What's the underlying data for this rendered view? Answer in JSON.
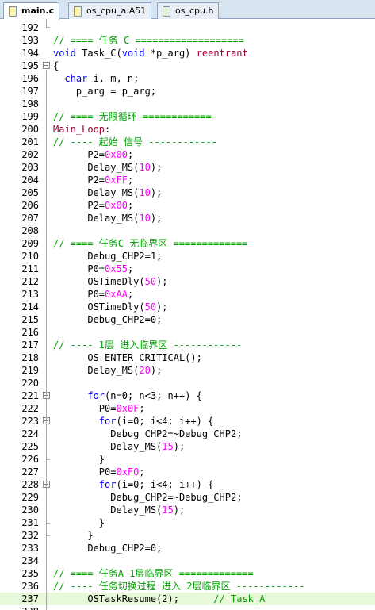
{
  "tabs": [
    {
      "label": "main.c",
      "active": true
    },
    {
      "label": "os_cpu_a.A51",
      "active": false
    },
    {
      "label": "os_cpu.h",
      "active": false
    }
  ],
  "lines": [
    {
      "n": "192",
      "segs": []
    },
    {
      "n": "193",
      "segs": [
        {
          "c": "cm",
          "t": "// ==== 任务 C ==================="
        }
      ]
    },
    {
      "n": "194",
      "segs": [
        {
          "c": "kw",
          "t": "void"
        },
        {
          "c": "txt",
          "t": " Task_C("
        },
        {
          "c": "kw",
          "t": "void"
        },
        {
          "c": "txt",
          "t": " *p_arg) "
        },
        {
          "c": "lbl",
          "t": "reentrant"
        }
      ]
    },
    {
      "n": "195",
      "fold": "-",
      "segs": [
        {
          "c": "txt",
          "t": "{"
        }
      ]
    },
    {
      "n": "196",
      "segs": [
        {
          "c": "txt",
          "t": "  "
        },
        {
          "c": "kw",
          "t": "char"
        },
        {
          "c": "txt",
          "t": " i, m, n;"
        }
      ]
    },
    {
      "n": "197",
      "segs": [
        {
          "c": "txt",
          "t": "    p_arg = p_arg;"
        }
      ]
    },
    {
      "n": "198",
      "segs": []
    },
    {
      "n": "199",
      "segs": [
        {
          "c": "cm",
          "t": "// ==== 无限循环 ============"
        }
      ]
    },
    {
      "n": "200",
      "segs": [
        {
          "c": "lbl",
          "t": "Main_Loop"
        },
        {
          "c": "txt",
          "t": ":"
        }
      ]
    },
    {
      "n": "201",
      "segs": [
        {
          "c": "cm",
          "t": "// ---- 起始 信号 ------------"
        }
      ]
    },
    {
      "n": "202",
      "segs": [
        {
          "c": "txt",
          "t": "      P2="
        },
        {
          "c": "num",
          "t": "0x00"
        },
        {
          "c": "txt",
          "t": ";"
        }
      ]
    },
    {
      "n": "203",
      "segs": [
        {
          "c": "txt",
          "t": "      Delay_MS("
        },
        {
          "c": "num",
          "t": "10"
        },
        {
          "c": "txt",
          "t": ");"
        }
      ]
    },
    {
      "n": "204",
      "segs": [
        {
          "c": "txt",
          "t": "      P2="
        },
        {
          "c": "num",
          "t": "0xFF"
        },
        {
          "c": "txt",
          "t": ";"
        }
      ]
    },
    {
      "n": "205",
      "segs": [
        {
          "c": "txt",
          "t": "      Delay_MS("
        },
        {
          "c": "num",
          "t": "10"
        },
        {
          "c": "txt",
          "t": ");"
        }
      ]
    },
    {
      "n": "206",
      "segs": [
        {
          "c": "txt",
          "t": "      P2="
        },
        {
          "c": "num",
          "t": "0x00"
        },
        {
          "c": "txt",
          "t": ";"
        }
      ]
    },
    {
      "n": "207",
      "segs": [
        {
          "c": "txt",
          "t": "      Delay_MS("
        },
        {
          "c": "num",
          "t": "10"
        },
        {
          "c": "txt",
          "t": ");"
        }
      ]
    },
    {
      "n": "208",
      "segs": []
    },
    {
      "n": "209",
      "segs": [
        {
          "c": "cm",
          "t": "// ==== 任务C 无临界区 ============="
        }
      ]
    },
    {
      "n": "210",
      "segs": [
        {
          "c": "txt",
          "t": "      Debug_CHP2=1;"
        }
      ]
    },
    {
      "n": "211",
      "segs": [
        {
          "c": "txt",
          "t": "      P0="
        },
        {
          "c": "num",
          "t": "0x55"
        },
        {
          "c": "txt",
          "t": ";"
        }
      ]
    },
    {
      "n": "212",
      "segs": [
        {
          "c": "txt",
          "t": "      OSTimeDly("
        },
        {
          "c": "num",
          "t": "50"
        },
        {
          "c": "txt",
          "t": ");"
        }
      ]
    },
    {
      "n": "213",
      "segs": [
        {
          "c": "txt",
          "t": "      P0="
        },
        {
          "c": "num",
          "t": "0xAA"
        },
        {
          "c": "txt",
          "t": ";"
        }
      ]
    },
    {
      "n": "214",
      "segs": [
        {
          "c": "txt",
          "t": "      OSTimeDly("
        },
        {
          "c": "num",
          "t": "50"
        },
        {
          "c": "txt",
          "t": ");"
        }
      ]
    },
    {
      "n": "215",
      "segs": [
        {
          "c": "txt",
          "t": "      Debug_CHP2=0;"
        }
      ]
    },
    {
      "n": "216",
      "segs": []
    },
    {
      "n": "217",
      "segs": [
        {
          "c": "cm",
          "t": "// ---- 1层 进入临界区 ------------"
        }
      ]
    },
    {
      "n": "218",
      "segs": [
        {
          "c": "txt",
          "t": "      OS_ENTER_CRITICAL();"
        }
      ]
    },
    {
      "n": "219",
      "segs": [
        {
          "c": "txt",
          "t": "      Delay_MS("
        },
        {
          "c": "num",
          "t": "20"
        },
        {
          "c": "txt",
          "t": ");"
        }
      ]
    },
    {
      "n": "220",
      "segs": []
    },
    {
      "n": "221",
      "fold": "-",
      "segs": [
        {
          "c": "txt",
          "t": "      "
        },
        {
          "c": "kw",
          "t": "for"
        },
        {
          "c": "txt",
          "t": "(n=0; n<3; n++) {"
        }
      ]
    },
    {
      "n": "222",
      "segs": [
        {
          "c": "txt",
          "t": "        P0="
        },
        {
          "c": "num",
          "t": "0x0F"
        },
        {
          "c": "txt",
          "t": ";"
        }
      ]
    },
    {
      "n": "223",
      "fold": "-",
      "segs": [
        {
          "c": "txt",
          "t": "        "
        },
        {
          "c": "kw",
          "t": "for"
        },
        {
          "c": "txt",
          "t": "(i=0; i<4; i++) {"
        }
      ]
    },
    {
      "n": "224",
      "segs": [
        {
          "c": "txt",
          "t": "          Debug_CHP2=~Debug_CHP2;"
        }
      ]
    },
    {
      "n": "225",
      "segs": [
        {
          "c": "txt",
          "t": "          Delay_MS("
        },
        {
          "c": "num",
          "t": "15"
        },
        {
          "c": "txt",
          "t": ");"
        }
      ]
    },
    {
      "n": "226",
      "segs": [
        {
          "c": "txt",
          "t": "        }"
        }
      ]
    },
    {
      "n": "227",
      "segs": [
        {
          "c": "txt",
          "t": "        P0="
        },
        {
          "c": "num",
          "t": "0xF0"
        },
        {
          "c": "txt",
          "t": ";"
        }
      ]
    },
    {
      "n": "228",
      "fold": "-",
      "segs": [
        {
          "c": "txt",
          "t": "        "
        },
        {
          "c": "kw",
          "t": "for"
        },
        {
          "c": "txt",
          "t": "(i=0; i<4; i++) {"
        }
      ]
    },
    {
      "n": "229",
      "segs": [
        {
          "c": "txt",
          "t": "          Debug_CHP2=~Debug_CHP2;"
        }
      ]
    },
    {
      "n": "230",
      "segs": [
        {
          "c": "txt",
          "t": "          Delay_MS("
        },
        {
          "c": "num",
          "t": "15"
        },
        {
          "c": "txt",
          "t": ");"
        }
      ]
    },
    {
      "n": "231",
      "segs": [
        {
          "c": "txt",
          "t": "        }"
        }
      ]
    },
    {
      "n": "232",
      "segs": [
        {
          "c": "txt",
          "t": "      }"
        }
      ]
    },
    {
      "n": "233",
      "segs": [
        {
          "c": "txt",
          "t": "      Debug_CHP2=0;"
        }
      ]
    },
    {
      "n": "234",
      "segs": []
    },
    {
      "n": "235",
      "segs": [
        {
          "c": "cm",
          "t": "// ==== 任务A 1层临界区 ============="
        }
      ]
    },
    {
      "n": "236",
      "segs": [
        {
          "c": "cm",
          "t": "// ---- 任务切换过程 进入 2层临界区 ------------"
        }
      ]
    },
    {
      "n": "237",
      "highlight": true,
      "segs": [
        {
          "c": "txt",
          "t": "      OSTaskResume(2);      "
        },
        {
          "c": "cm",
          "t": "// Task_A"
        }
      ]
    },
    {
      "n": "238",
      "segs": []
    }
  ],
  "colors": {
    "comment": "#009f00",
    "keyword": "#0000ff",
    "number": "#ff00ff",
    "label": "#a00030",
    "current_line": "#e7f9d8"
  }
}
